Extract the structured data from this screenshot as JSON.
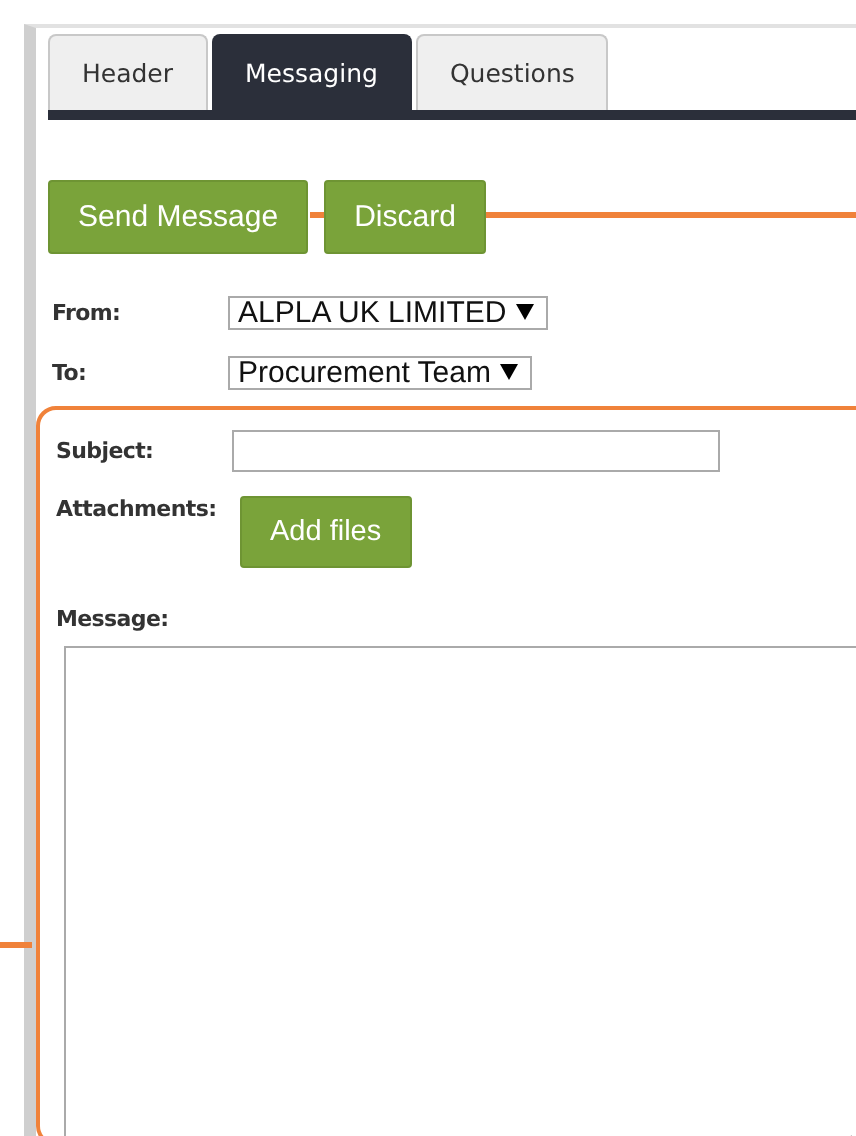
{
  "tabs": [
    {
      "label": "Header",
      "selected": false
    },
    {
      "label": "Messaging",
      "selected": true
    },
    {
      "label": "Questions",
      "selected": false
    }
  ],
  "actions": [
    {
      "label": "Send Message"
    },
    {
      "label": "Discard"
    }
  ],
  "from": {
    "label": "From:",
    "value": "ALPLA UK LIMITED"
  },
  "to": {
    "label": "To:",
    "value": "Procurement Team"
  },
  "subject": {
    "label": "Subject:"
  },
  "attachments": {
    "label": "Attachments:",
    "button": "Add files"
  },
  "message": {
    "label": "Message:"
  }
}
